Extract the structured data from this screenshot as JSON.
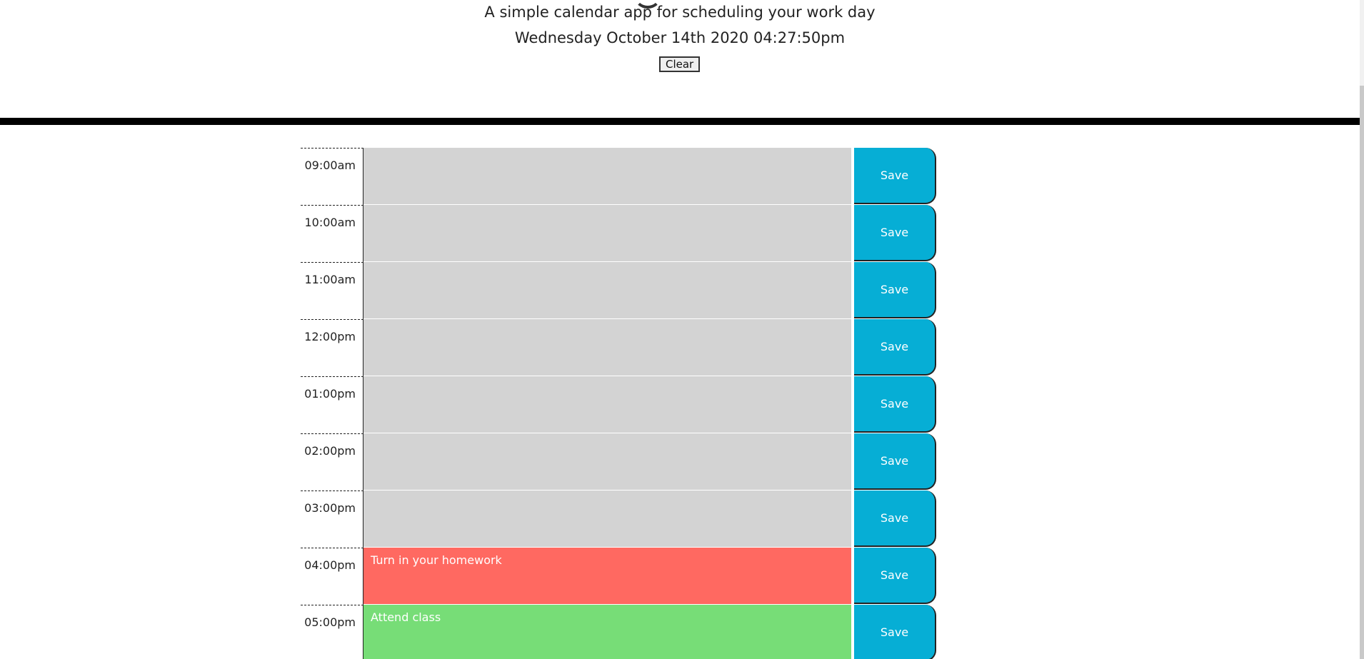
{
  "header": {
    "lead": "A simple calendar app for scheduling your work day",
    "current_day": "Wednesday October 14th 2020 04:27:50pm",
    "clear_label": "Clear"
  },
  "planner": {
    "save_label": "Save",
    "rows": [
      {
        "hour": "09:00am",
        "text": "",
        "status": "past"
      },
      {
        "hour": "10:00am",
        "text": "",
        "status": "past"
      },
      {
        "hour": "11:00am",
        "text": "",
        "status": "past"
      },
      {
        "hour": "12:00pm",
        "text": "",
        "status": "past"
      },
      {
        "hour": "01:00pm",
        "text": "",
        "status": "past"
      },
      {
        "hour": "02:00pm",
        "text": "",
        "status": "past"
      },
      {
        "hour": "03:00pm",
        "text": "",
        "status": "past"
      },
      {
        "hour": "04:00pm",
        "text": "Turn in your homework",
        "status": "present"
      },
      {
        "hour": "05:00pm",
        "text": "Attend class",
        "status": "future"
      }
    ]
  },
  "colors": {
    "past": "#d3d3d3",
    "present": "#ff6961",
    "future": "#77dd77",
    "save": "#06aed5"
  }
}
